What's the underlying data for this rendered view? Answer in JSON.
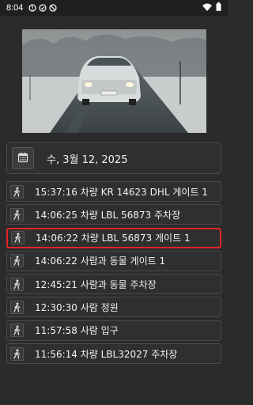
{
  "status_bar": {
    "time": "8:04",
    "left_icons": [
      "alert-circle-icon",
      "shield-icon",
      "do-not-disturb-icon"
    ],
    "right_icons": [
      "wifi-icon",
      "battery-icon"
    ]
  },
  "camera": {
    "description_icon": "camera-snapshot-image"
  },
  "date_picker": {
    "icon": "calendar-icon",
    "date": "수, 3월 12, 2025"
  },
  "events": [
    {
      "text": "15:37:16 차량 KR 14623 DHL 게이트 1",
      "selected": false,
      "icon": "walking-person-icon"
    },
    {
      "text": "14:06:25 차량 LBL 56873 주차장",
      "selected": false,
      "icon": "walking-person-icon"
    },
    {
      "text": "14:06:22 차량 LBL 56873 게이트 1",
      "selected": true,
      "icon": "walking-person-icon"
    },
    {
      "text": "14:06:22 사람과 동물 게이트 1",
      "selected": false,
      "icon": "walking-person-icon"
    },
    {
      "text": "12:45:21 사람과 동물 주차장",
      "selected": false,
      "icon": "walking-person-icon"
    },
    {
      "text": "12:30:30 사람 정원",
      "selected": false,
      "icon": "walking-person-icon"
    },
    {
      "text": "11:57:58 사람 입구",
      "selected": false,
      "icon": "walking-person-icon"
    },
    {
      "text": "11:56:14 차량 LBL32027 주차장",
      "selected": false,
      "icon": "walking-person-icon"
    }
  ],
  "colors": {
    "background": "#2b2b2b",
    "card": "#2f2f2f",
    "selected_border": "#e0242b"
  }
}
